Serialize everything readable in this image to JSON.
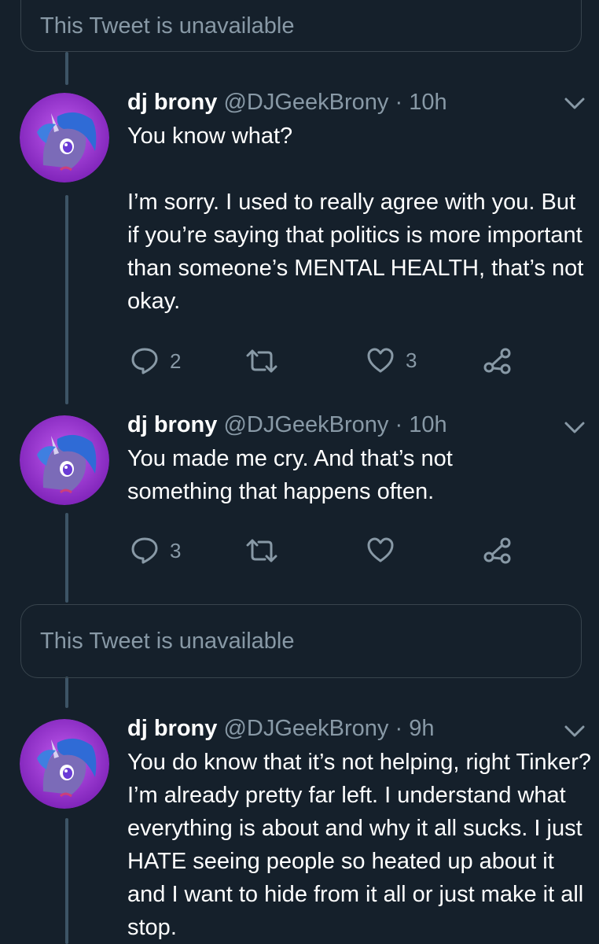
{
  "unavailable_text": "This Tweet is unavailable",
  "tweets": [
    {
      "name": "dj brony",
      "handle": "@DJGeekBrony",
      "dot": "·",
      "time": "10h",
      "text": "You know what?\n\nI’m sorry. I used to really agree with you. But if you’re saying that politics is more important than someone’s MENTAL HEALTH, that’s not okay.",
      "replies": "2",
      "retweets": "",
      "likes": "3"
    },
    {
      "name": "dj brony",
      "handle": "@DJGeekBrony",
      "dot": "·",
      "time": "10h",
      "text": "You made me cry. And that’s not something that happens often.",
      "replies": "3",
      "retweets": "",
      "likes": ""
    },
    {
      "name": "dj brony",
      "handle": "@DJGeekBrony",
      "dot": "·",
      "time": "9h",
      "text": "You do know that it’s not helping, right Tinker? I’m already pretty far left. I understand what everything is about and why it all sucks. I just HATE seeing people so heated up about it and I want to hide from it all or just make it all stop.",
      "replies": "",
      "retweets": "",
      "likes": ""
    }
  ],
  "icons": {
    "avatar": "pony-avatar-icon",
    "reply": "reply-icon",
    "retweet": "retweet-icon",
    "like": "heart-icon",
    "share": "share-icon",
    "menu": "chevron-down-icon"
  },
  "colors": {
    "background": "#15202b",
    "text": "#ffffff",
    "secondary": "#8899a6",
    "border": "#38444d",
    "thread_line": "#3d5466"
  }
}
